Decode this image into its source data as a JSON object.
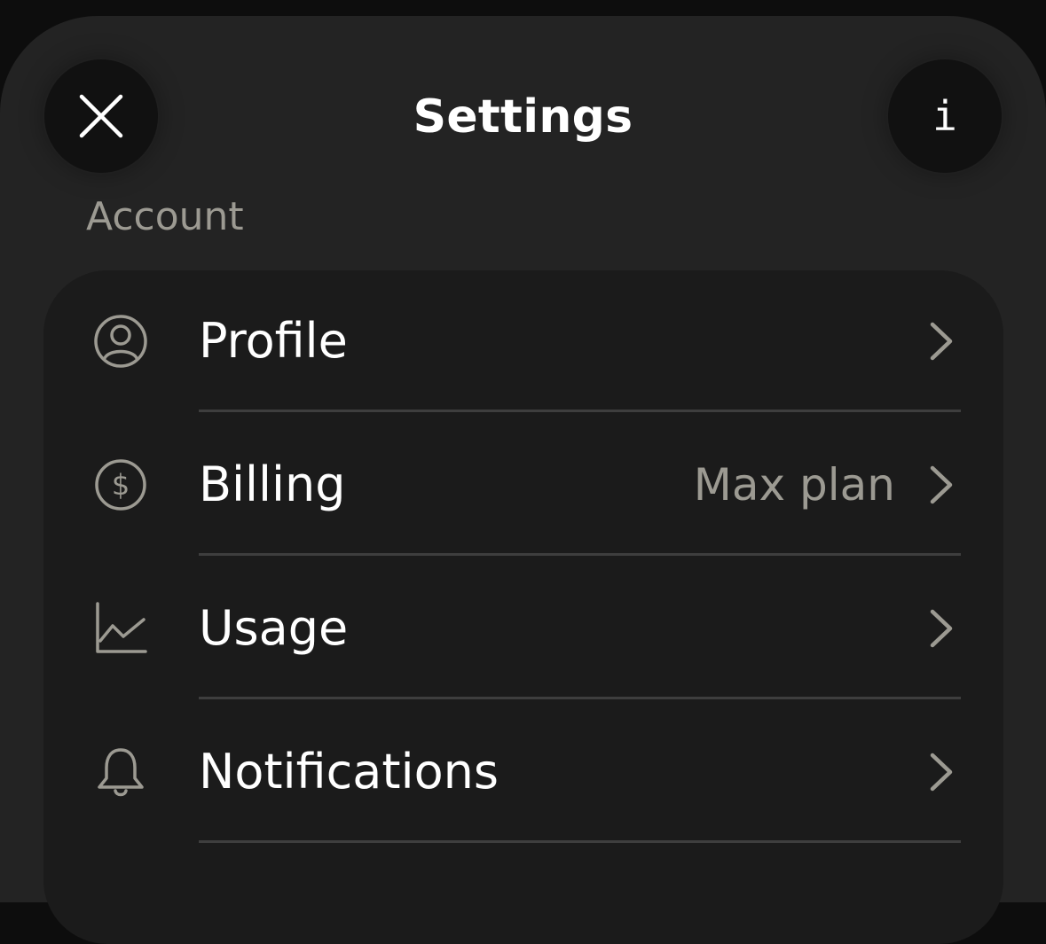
{
  "header": {
    "title": "Settings",
    "close_icon": "close-icon",
    "info_label": "i"
  },
  "section": {
    "label": "Account"
  },
  "rows": [
    {
      "label": "Profile",
      "icon": "profile-icon",
      "value": ""
    },
    {
      "label": "Billing",
      "icon": "dollar-circle-icon",
      "value": "Max plan"
    },
    {
      "label": "Usage",
      "icon": "chart-icon",
      "value": ""
    },
    {
      "label": "Notifications",
      "icon": "bell-icon",
      "value": ""
    }
  ],
  "colors": {
    "background": "#232323",
    "card": "#1b1b1b",
    "text": "#ffffff",
    "muted": "#9c9a92",
    "divider": "#3e3e3e"
  }
}
